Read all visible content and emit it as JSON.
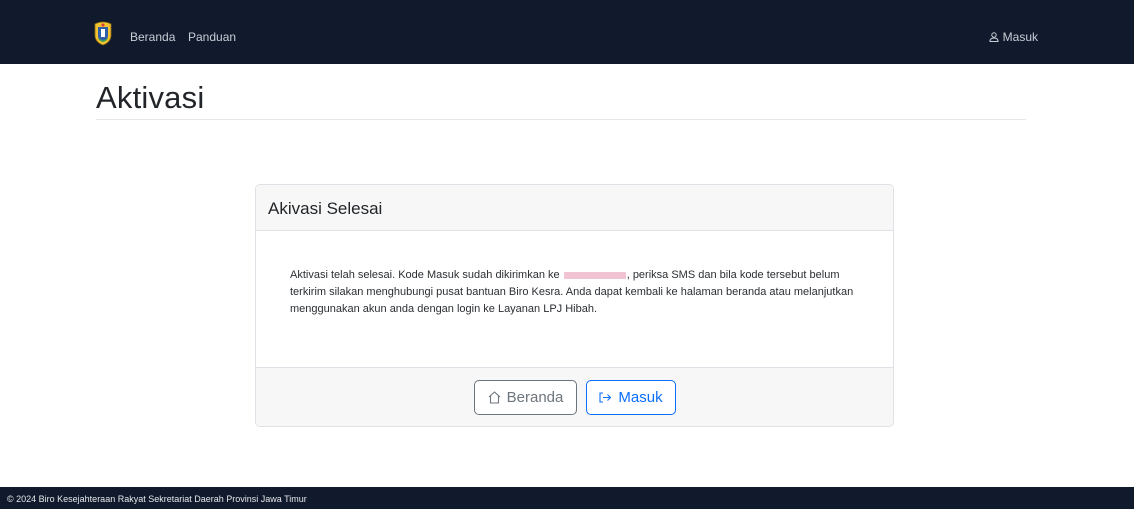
{
  "navbar": {
    "links": [
      {
        "label": "Beranda"
      },
      {
        "label": "Panduan"
      }
    ],
    "login_label": "Masuk"
  },
  "page": {
    "title": "Aktivasi"
  },
  "card": {
    "header": "Akivasi Selesai",
    "body_before": "Aktivasi telah selesai. Kode Masuk sudah dikirimkan ke",
    "body_after": ", periksa SMS dan bila kode tersebut belum terkirim silakan menghubungi pusat bantuan Biro Kesra. Anda dapat kembali ke halaman beranda atau melanjutkan menggunakan akun anda dengan login ke Layanan LPJ Hibah.",
    "buttons": {
      "home_label": "Beranda",
      "login_label": "Masuk"
    }
  },
  "footer": {
    "text": "© 2024 Biro Kesejahteraan Rakyat Sekretariat Daerah Provinsi Jawa Timur"
  },
  "colors": {
    "navbar_bg": "#111a2c",
    "primary": "#0d6efd",
    "secondary": "#6c757d",
    "redaction": "#f2c3d2"
  }
}
